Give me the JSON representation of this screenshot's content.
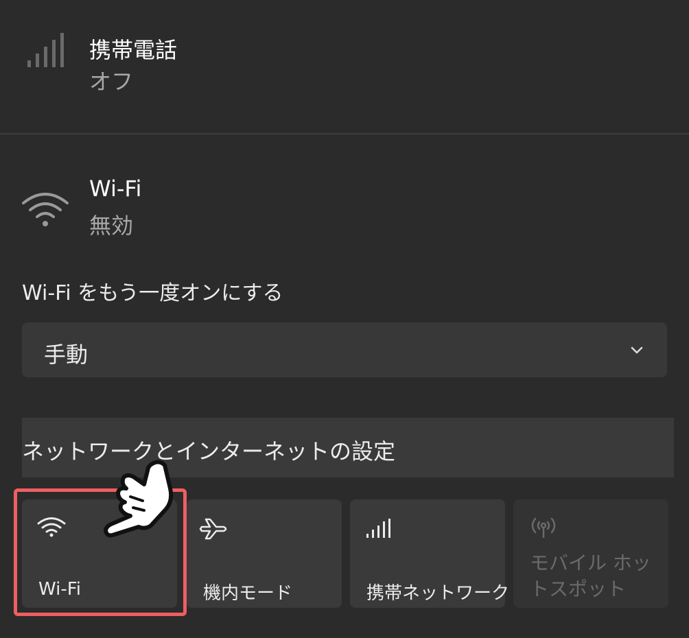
{
  "cellular": {
    "title": "携帯電話",
    "status": "オフ",
    "icon": "signal-bars-icon"
  },
  "wifi": {
    "title": "Wi-Fi",
    "status": "無効",
    "icon": "wifi-icon"
  },
  "reenable_label": "Wi-Fi をもう一度オンにする",
  "reenable_dropdown": {
    "value": "手動",
    "icon": "chevron-down-icon"
  },
  "settings_link": "ネットワークとインターネットの設定",
  "quick_tiles": [
    {
      "label": "Wi-Fi",
      "icon": "wifi-icon"
    },
    {
      "label": "機内モード",
      "icon": "airplane-icon"
    },
    {
      "label": "携帯ネットワーク",
      "icon": "signal-bars-icon"
    },
    {
      "label": "モバイル ホットスポット",
      "icon": "hotspot-icon"
    }
  ],
  "colors": {
    "background": "#2b2b2b",
    "highlight": "#ef5e62"
  }
}
